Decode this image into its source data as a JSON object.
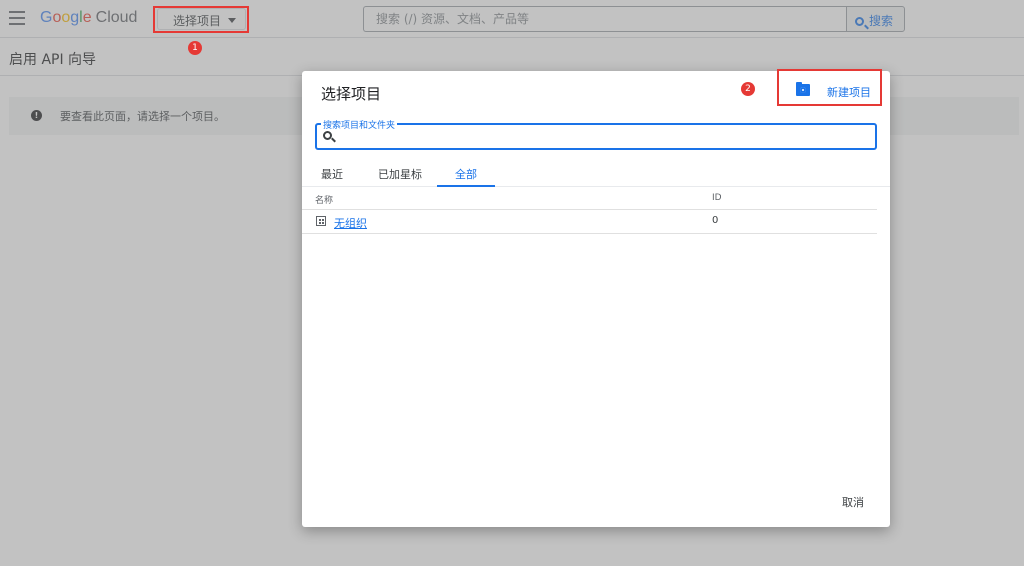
{
  "topbar": {
    "logo": {
      "letters": [
        "G",
        "o",
        "o",
        "g",
        "l",
        "e"
      ],
      "product": "Cloud"
    },
    "project_picker_label": "选择项目",
    "search_placeholder": "搜索 (/) 资源、文档、产品等",
    "search_button_label": "搜索"
  },
  "page": {
    "title": "启用 API 向导",
    "notice_text": "要查看此页面，请选择一个项目。"
  },
  "annotations": {
    "badge_1": "1",
    "badge_2": "2",
    "highlight_color": "#e53935"
  },
  "dialog": {
    "title": "选择项目",
    "new_project_label": "新建项目",
    "filter_label": "搜索项目和文件夹",
    "filter_value": "",
    "tabs": [
      {
        "label": "最近",
        "active": false
      },
      {
        "label": "已加星标",
        "active": false
      },
      {
        "label": "全部",
        "active": true
      }
    ],
    "columns": {
      "name": "名称",
      "id": "ID"
    },
    "rows": [
      {
        "icon": "building-icon",
        "name": "无组织",
        "id": "0"
      }
    ],
    "cancel_label": "取消"
  },
  "colors": {
    "accent": "#1a73e8"
  }
}
